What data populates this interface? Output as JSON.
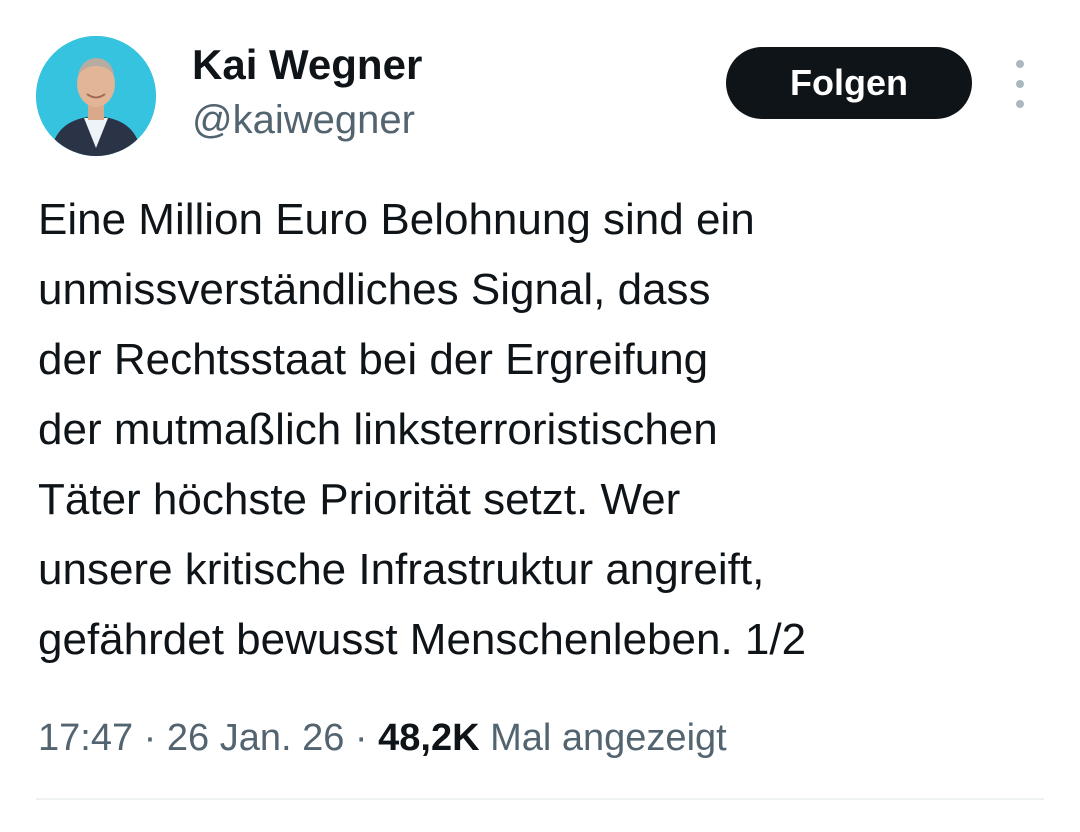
{
  "author": {
    "display_name": "Kai Wegner",
    "handle": "@kaiwegner",
    "avatar_background": "#35c3e0"
  },
  "actions": {
    "follow_label": "Folgen",
    "more_icon": "more-vertical-icon"
  },
  "tweet": {
    "lines": [
      "Eine Million Euro Belohnung sind ein",
      "unmissverständliches Signal, dass",
      "der Rechtsstaat bei der Ergreifung",
      "der mutmaßlich linksterroristischen",
      "Täter höchste Priorität setzt. Wer",
      "unsere kritische Infrastruktur angreift,",
      "gefährdet bewusst Menschenleben. 1/2"
    ],
    "time": "17:47",
    "date": "26 Jan. 26",
    "separator": "·",
    "views_count": "48,2K",
    "views_label": "Mal angezeigt"
  }
}
